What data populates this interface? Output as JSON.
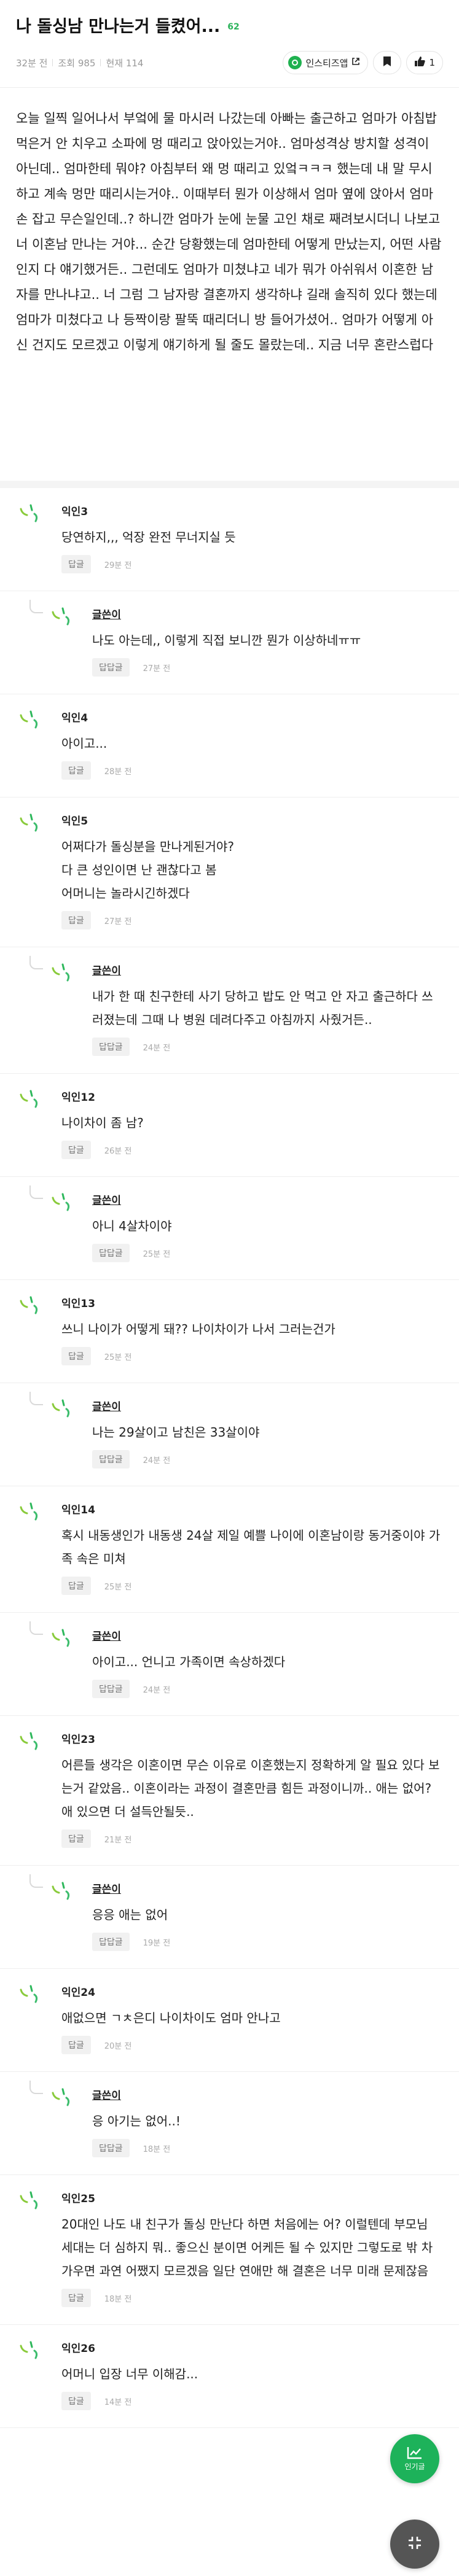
{
  "post": {
    "title": "나 돌싱남 만나는거 들켰어...",
    "comment_count": "62",
    "time": "32분 전",
    "views": "조회 985",
    "hearts": "현재 114",
    "instagram_label": "인스티즈앱",
    "like_count": "1",
    "body": "오늘 일찍 일어나서 부엌에 물 마시러 나갔는데 아빠는 출근하고 엄마가 아침밥 먹은거 안 치우고 소파에 멍 때리고 앉아있는거야.. 엄마성격상 방치할 성격이 아닌데.. 엄마한테 뭐야? 아침부터 왜 멍 때리고 있엌ㅋㅋㅋ 했는데 내 말 무시하고 계속 멍만 때리시는거야.. 이때부터 뭔가 이상해서 엄마 옆에 앉아서 엄마 손 잡고 무슨일인데..? 하니깐 엄마가 눈에 눈물 고인 채로 째려보시더니 나보고 너 이혼남 만나는 거야... 순간 당황했는데 엄마한테 어떻게 만났는지, 어떤 사람인지 다 얘기했거든.. 그런데도 엄마가 미쳤냐고 네가 뭐가 아쉬워서 이혼한 남자를 만나냐고.. 너 그럼 그 남자랑 결혼까지 생각하냐 길래 솔직히 있다 했는데 엄마가 미쳤다고 나 등짝이랑 팔뚝 때리더니 방 들어가셨어.. 엄마가 어떻게 아신 건지도 모르겠고 이렇게 얘기하게 될 줄도 몰랐는데.. 지금 너무 혼란스럽다"
  },
  "labels": {
    "reply": "답글",
    "reply_reply": "답답글"
  },
  "fab": {
    "label": "인기글"
  },
  "comments": [
    {
      "type": "top",
      "author": "익인3",
      "text": "당연하지,,, 억장 완전 무너지실 듯",
      "time": "29분 전"
    },
    {
      "type": "reply",
      "author": "글쓴이",
      "text": "나도 아는데,, 이렇게 직접 보니깐 뭔가 이상하네ㅠㅠ",
      "time": "27분 전"
    },
    {
      "type": "top",
      "author": "익인4",
      "text": "아이고...",
      "time": "28분 전"
    },
    {
      "type": "top",
      "author": "익인5",
      "text": "어쩌다가 돌싱분을 만나게된거야?\n다 큰 성인이면 난 괜찮다고 봄\n어머니는 놀라시긴하겠다",
      "time": "27분 전"
    },
    {
      "type": "reply",
      "author": "글쓴이",
      "text": "내가 한 때 친구한테 사기 당하고 밥도 안 먹고 안 자고 출근하다 쓰러졌는데 그때 나 병원 데려다주고 아침까지 사줬거든..",
      "time": "24분 전"
    },
    {
      "type": "top",
      "author": "익인12",
      "text": "나이차이 좀 남?",
      "time": "26분 전"
    },
    {
      "type": "reply",
      "author": "글쓴이",
      "text": "아니 4살차이야",
      "time": "25분 전"
    },
    {
      "type": "top",
      "author": "익인13",
      "text": "쓰니 나이가 어떻게 돼?? 나이차이가 나서 그러는건가",
      "time": "25분 전"
    },
    {
      "type": "reply",
      "author": "글쓴이",
      "text": "나는 29살이고 남친은 33살이야",
      "time": "24분 전"
    },
    {
      "type": "top",
      "author": "익인14",
      "text": "혹시 내동생인가 내동생 24살 제일 예쁠 나이에 이혼남이랑 동거중이야 가족 속은 미쳐",
      "time": "25분 전"
    },
    {
      "type": "reply",
      "author": "글쓴이",
      "text": "아이고... 언니고 가족이면 속상하겠다",
      "time": "24분 전"
    },
    {
      "type": "top",
      "author": "익인23",
      "text": "어른들 생각은 이혼이면 무슨 이유로 이혼했는지 정확하게 알 필요 있다 보는거 같았음.. 이혼이라는 과정이 결혼만큼 힘든 과정이니까.. 애는 없어? 애 있으면 더 설득안될듯..",
      "time": "21분 전"
    },
    {
      "type": "reply",
      "author": "글쓴이",
      "text": "응응 애는 없어",
      "time": "19분 전"
    },
    {
      "type": "top",
      "author": "익인24",
      "text": "애없으면 ㄱㅊ은디 나이차이도 엄마 안나고",
      "time": "20분 전"
    },
    {
      "type": "reply",
      "author": "글쓴이",
      "text": "응 아기는 없어..!",
      "time": "18분 전"
    },
    {
      "type": "top",
      "author": "익인25",
      "text": "20대인 나도 내 친구가 돌싱 만난다 하면 처음에는 어? 이럴텐데 부모님 세대는 더 심하지 뭐.. 좋으신 분이면 어케든 될 수 있지만 그렇도로 밖 차가우면 과연 어쨌지 모르겠음 일단 연애만 해 결혼은 너무 미래 문제잖음",
      "time": "18분 전"
    },
    {
      "type": "top",
      "author": "익인26",
      "text": "어머니 입장 너무 이해감...",
      "time": "14분 전"
    }
  ]
}
